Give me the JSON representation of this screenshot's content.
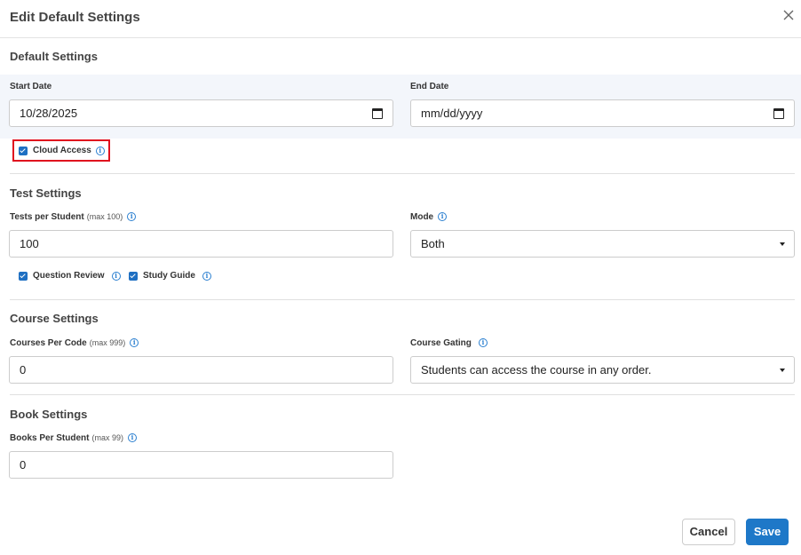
{
  "modal": {
    "title": "Edit Default Settings"
  },
  "default_settings": {
    "title": "Default Settings",
    "start_date_label": "Start Date",
    "start_date_value": "10/28/2025",
    "end_date_label": "End Date",
    "end_date_placeholder": "mm/dd/yyyy",
    "cloud_access_label": "Cloud Access"
  },
  "test_settings": {
    "title": "Test Settings",
    "tests_label": "Tests per Student",
    "tests_max": "(max 100)",
    "tests_value": "100",
    "mode_label": "Mode",
    "mode_value": "Both",
    "question_review_label": "Question Review",
    "study_guide_label": "Study Guide"
  },
  "course_settings": {
    "title": "Course Settings",
    "courses_label": "Courses Per Code",
    "courses_max": "(max 999)",
    "courses_value": "0",
    "gating_label": "Course Gating",
    "gating_value": "Students can access the course in any order."
  },
  "book_settings": {
    "title": "Book Settings",
    "books_label": "Books Per Student",
    "books_max": "(max 99)",
    "books_value": "0"
  },
  "footer": {
    "cancel_label": "Cancel",
    "save_label": "Save"
  },
  "colors": {
    "accent": "#1e78c8",
    "highlight": "#e0101e",
    "band": "#f3f6fb"
  }
}
